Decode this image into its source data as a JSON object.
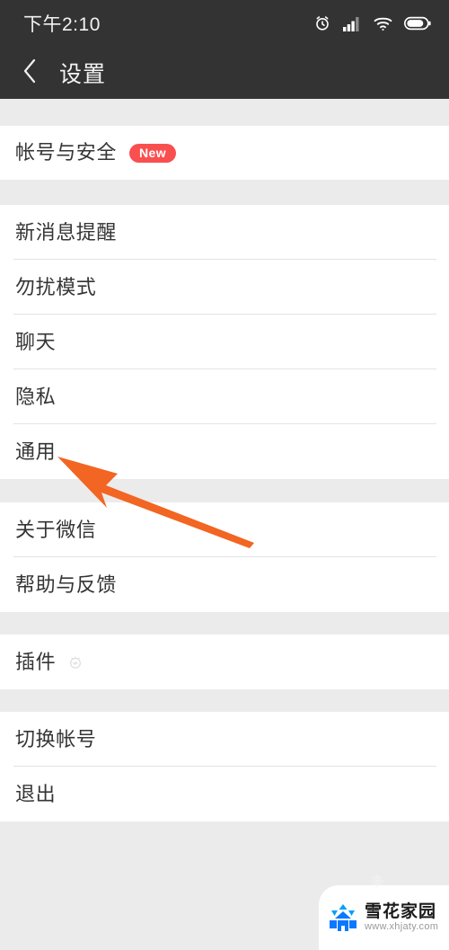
{
  "status_bar": {
    "time": "下午2:10",
    "icons": [
      "alarm-icon",
      "signal-icon",
      "wifi-icon",
      "battery-icon"
    ]
  },
  "nav_bar": {
    "back_icon": "chevron-left-icon",
    "title": "设置"
  },
  "colors": {
    "bar_background": "#333333",
    "page_background": "#ebebeb",
    "row_background": "#ffffff",
    "badge_red": "#fa4f4f",
    "arrow_orange": "#f26522",
    "separator": "#e3e3e3",
    "text_primary": "#353535"
  },
  "groups": [
    {
      "name": "account-group",
      "items": [
        {
          "label": "帐号与安全",
          "badge": "New"
        }
      ]
    },
    {
      "name": "preferences-group",
      "items": [
        {
          "label": "新消息提醒"
        },
        {
          "label": "勿扰模式"
        },
        {
          "label": "聊天"
        },
        {
          "label": "隐私"
        },
        {
          "label": "通用"
        }
      ]
    },
    {
      "name": "about-group",
      "items": [
        {
          "label": "关于微信"
        },
        {
          "label": "帮助与反馈"
        }
      ]
    },
    {
      "name": "plugin-group",
      "items": [
        {
          "label": "插件",
          "trailing_icon": "plugin-dot-icon"
        }
      ]
    },
    {
      "name": "account-actions-group",
      "items": [
        {
          "label": "切换帐号"
        },
        {
          "label": "退出"
        }
      ]
    }
  ],
  "annotation": {
    "type": "arrow",
    "color": "#f26522",
    "points_to": "通用"
  },
  "watermark": {
    "name": "雪花家园",
    "url": "www.xhjaty.com",
    "logo": "snowflake-logo"
  }
}
